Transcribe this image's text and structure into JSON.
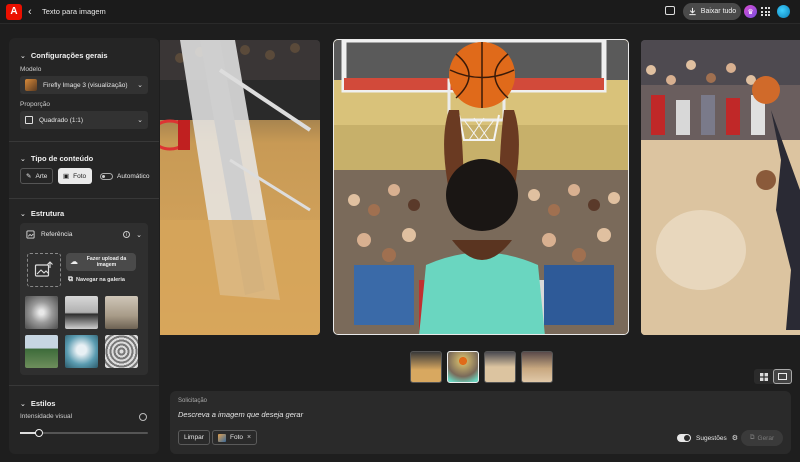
{
  "topbar": {
    "logo_letter": "A",
    "back_glyph": "‹",
    "title": "Texto para imagem",
    "download_all": "Baixar tudo",
    "icons": [
      "adobe-logo-icon",
      "back-chevron-icon",
      "chat-icon",
      "download-icon",
      "premium-crown-icon",
      "apps-grid-icon",
      "avatar-icon"
    ]
  },
  "sidebar": {
    "general": {
      "heading": "Configurações gerais",
      "model_label": "Modelo",
      "model_value": "Firefly Image 3 (visualização)",
      "ratio_label": "Proporção",
      "ratio_value": "Quadrado (1:1)"
    },
    "content_type": {
      "heading": "Tipo de conteúdo",
      "art": "Arte",
      "photo": "Foto",
      "auto": "Automático",
      "selected": "Foto"
    },
    "structure": {
      "heading": "Estrutura",
      "reference": "Referência",
      "upload_button": "Fazer upload da imagem",
      "gallery_button": "Navegar na galeria"
    },
    "styles": {
      "heading": "Estilos",
      "intensity_label": "Intensidade visual",
      "intensity_value": 0.15
    }
  },
  "gallery": {
    "selected_index": 1,
    "thumbnail_count": 4
  },
  "prompt": {
    "title": "Solicitação",
    "placeholder": "Descreva a imagem que deseja gerar",
    "clear": "Limpar",
    "chip_label": "Foto",
    "suggestions": "Sugestões",
    "suggestions_on": true,
    "generate": "Gerar"
  },
  "colors": {
    "background": "#1e1e1e",
    "panel": "#252525",
    "accent_red": "#eb1000",
    "active_segment": "#eaeaea"
  }
}
